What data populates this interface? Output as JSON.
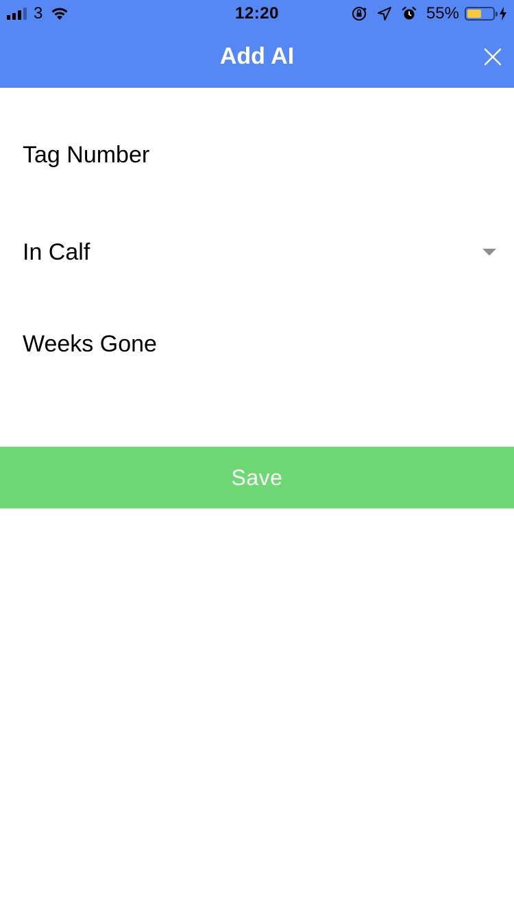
{
  "status_bar": {
    "carrier": "3",
    "time": "12:20",
    "battery_percent": "55%",
    "battery_level": 0.55,
    "icons": [
      "signal-icon",
      "wifi-icon",
      "orientation-lock-icon",
      "location-icon",
      "alarm-icon",
      "battery-icon",
      "charging-icon"
    ]
  },
  "header": {
    "title": "Add AI",
    "close_icon": "close-icon"
  },
  "form": {
    "tag_number_label": "Tag Number",
    "in_calf_label": "In Calf",
    "weeks_gone_label": "Weeks Gone",
    "dropdown_icon": "chevron-down-icon"
  },
  "actions": {
    "save_label": "Save"
  },
  "colors": {
    "header_bg": "#5588f5",
    "save_bg": "#6dd874",
    "battery_fill": "#f5c842"
  }
}
